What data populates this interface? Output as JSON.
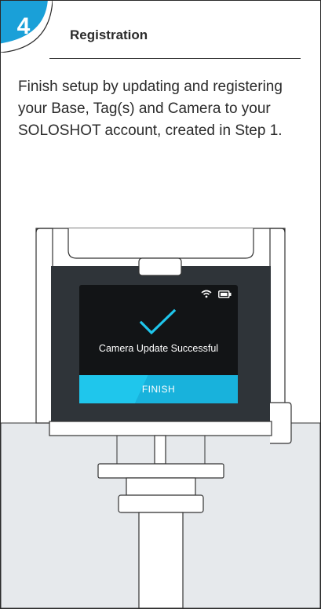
{
  "step": {
    "number": "4",
    "title": "Registration"
  },
  "description": "Finish setup by updating and registering your Base, Tag(s) and Camera to your SOLOSHOT account, created in Step 1.",
  "device_screen": {
    "message": "Camera Update Successful",
    "finish_label": "FINISH",
    "status_icons": [
      "wifi-icon",
      "battery-icon"
    ]
  },
  "colors": {
    "badge": "#1aa0d8",
    "accent": "#1fc6ec",
    "screen": "#121416",
    "frame": "#2f3439"
  }
}
